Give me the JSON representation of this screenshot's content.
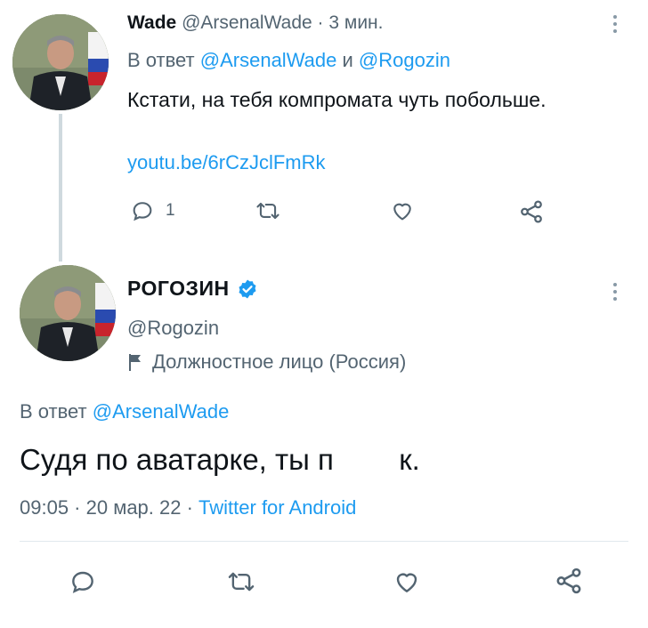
{
  "tweet1": {
    "name": "Wade",
    "handle": "@ArsenalWade",
    "separator": "·",
    "time": "3 мин.",
    "reply_prefix": "В ответ",
    "reply_user1": "@ArsenalWade",
    "reply_and": "и",
    "reply_user2": "@Rogozin",
    "text": "Кстати, на тебя компромата чуть побольше.",
    "link": "youtu.be/6rCzJclFmRk",
    "reply_count": "1"
  },
  "tweet2": {
    "name": "РОГОЗИН",
    "handle": "@Rogozin",
    "label": "Должностное лицо (Россия)",
    "reply_prefix": "В ответ",
    "reply_user": "@ArsenalWade",
    "text": "Судя по аватарке, ты п        к.",
    "timestamp": "09:05 · 20 мар. 22 ·",
    "source": "Twitter for Android"
  },
  "icons": {
    "reply": "reply-icon",
    "retweet": "retweet-icon",
    "like": "like-icon",
    "share": "share-icon",
    "verified": "verified-badge-icon",
    "flag": "flag-icon",
    "more": "more-icon"
  },
  "colors": {
    "link": "#1d9bf0",
    "secondary_text": "#536471",
    "primary_text": "#0f1419",
    "verified": "#1d9bf0"
  }
}
